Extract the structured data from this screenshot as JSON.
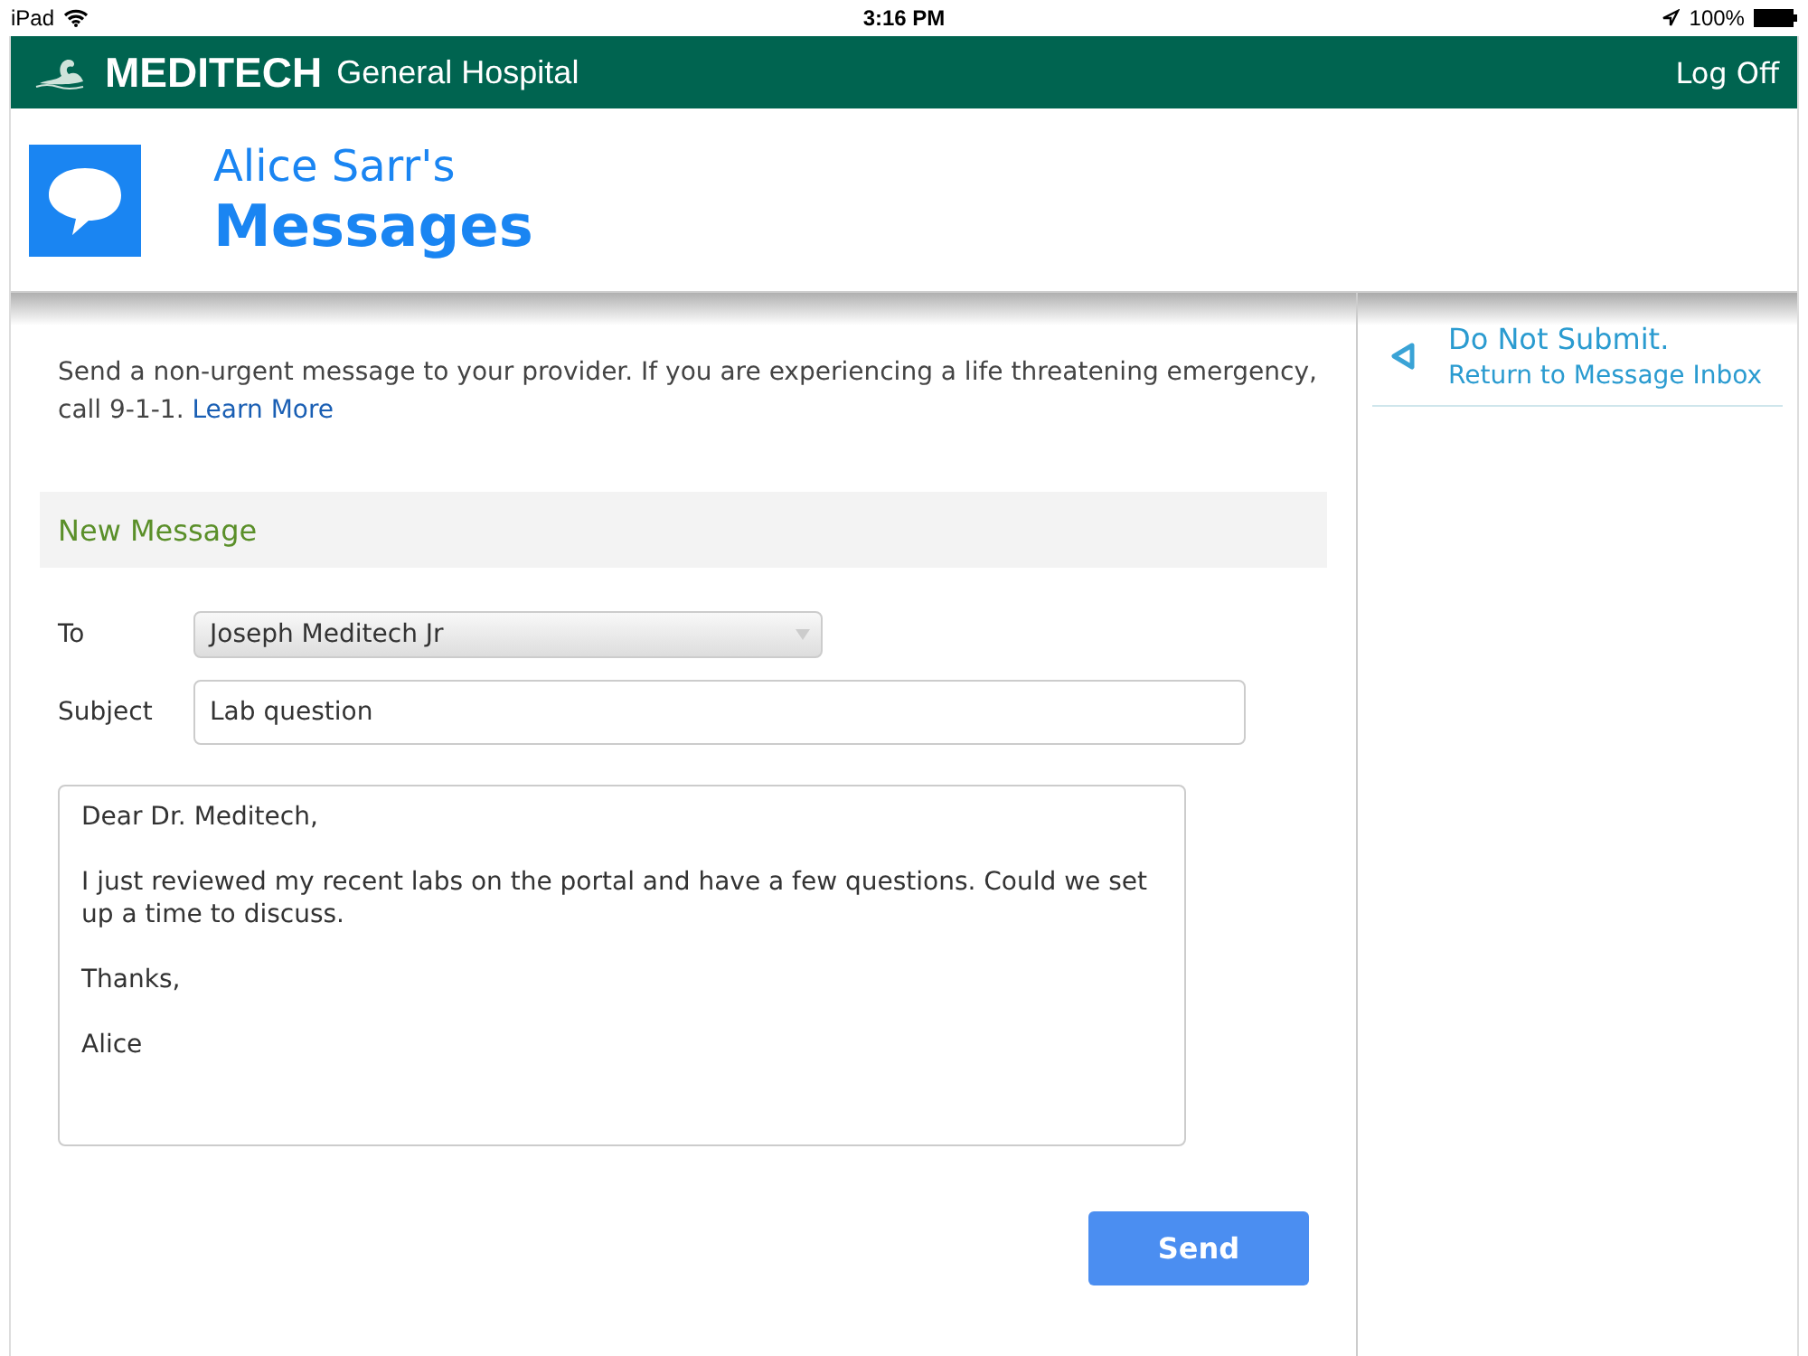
{
  "status_bar": {
    "device": "iPad",
    "time": "3:16 PM",
    "battery": "100%"
  },
  "app_bar": {
    "brand": "MEDITECH",
    "subtitle": "General Hospital",
    "log_off": "Log Off"
  },
  "page_header": {
    "owner": "Alice Sarr's",
    "title": "Messages"
  },
  "intro": {
    "text": "Send a non-urgent message to your provider. If you are experiencing a life threatening emergency, call 9-1-1.",
    "link": "Learn More"
  },
  "form": {
    "section_title": "New Message",
    "to": {
      "label": "To",
      "value": "Joseph Meditech Jr"
    },
    "subject": {
      "label": "Subject",
      "value": "Lab question"
    },
    "body": "Dear Dr. Meditech,\n\nI just reviewed my recent labs on the portal and have a few questions. Could we set up a time to discuss.\n\nThanks,\n\nAlice",
    "send": "Send"
  },
  "sidebar": {
    "title": "Do Not Submit.",
    "link": "Return to Message Inbox"
  }
}
